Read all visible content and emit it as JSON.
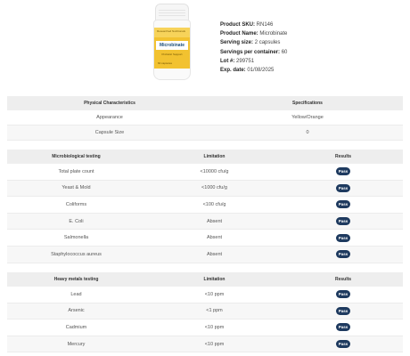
{
  "product": {
    "bottle": {
      "brand": "Researched Nutritionals",
      "name": "Microbinate",
      "subtitle": "Probiotic Support",
      "count": "60 capsules"
    },
    "info": [
      {
        "label": "Product SKU:",
        "value": "RN146"
      },
      {
        "label": "Product Name:",
        "value": "Microbinate"
      },
      {
        "label": "Serving size:",
        "value": "2 capsules"
      },
      {
        "label": "Servings per container:",
        "value": "60"
      },
      {
        "label": "Lot #:",
        "value": "299751"
      },
      {
        "label": "Exp. date:",
        "value": "01/08/2025"
      }
    ]
  },
  "physical": {
    "headers": [
      "Physical Characteristics",
      "Specifications"
    ],
    "rows": [
      [
        "Appearance",
        "Yellow/Orange"
      ],
      [
        "Capsule Size",
        "0"
      ]
    ]
  },
  "micro": {
    "headers": [
      "Microbiological testing",
      "Limitation",
      "Results"
    ],
    "rows": [
      [
        "Total plate count",
        "<10000 cfu/g",
        "Pass"
      ],
      [
        "Yeast & Mold",
        "<1000 cfu/g",
        "Pass"
      ],
      [
        "Coliforms",
        "<100 cfu/g",
        "Pass"
      ],
      [
        "E. Coli",
        "Absent",
        "Pass"
      ],
      [
        "Salmonella",
        "Absent",
        "Pass"
      ],
      [
        "Staphylococcus aureus",
        "Absent",
        "Pass"
      ]
    ]
  },
  "metals": {
    "headers": [
      "Heavy metals testing",
      "Limitation",
      "Results"
    ],
    "rows": [
      [
        "Lead",
        "<10 ppm",
        "Pass"
      ],
      [
        "Arsenic",
        "<1 ppm",
        "Pass"
      ],
      [
        "Cadmium",
        "<10 ppm",
        "Pass"
      ],
      [
        "Mercury",
        "<10 ppm",
        "Pass"
      ]
    ]
  },
  "colors": {
    "pass_badge": "#1e3a5f",
    "header_bg": "#eeeeee",
    "bottle_label": "#f2c230"
  }
}
